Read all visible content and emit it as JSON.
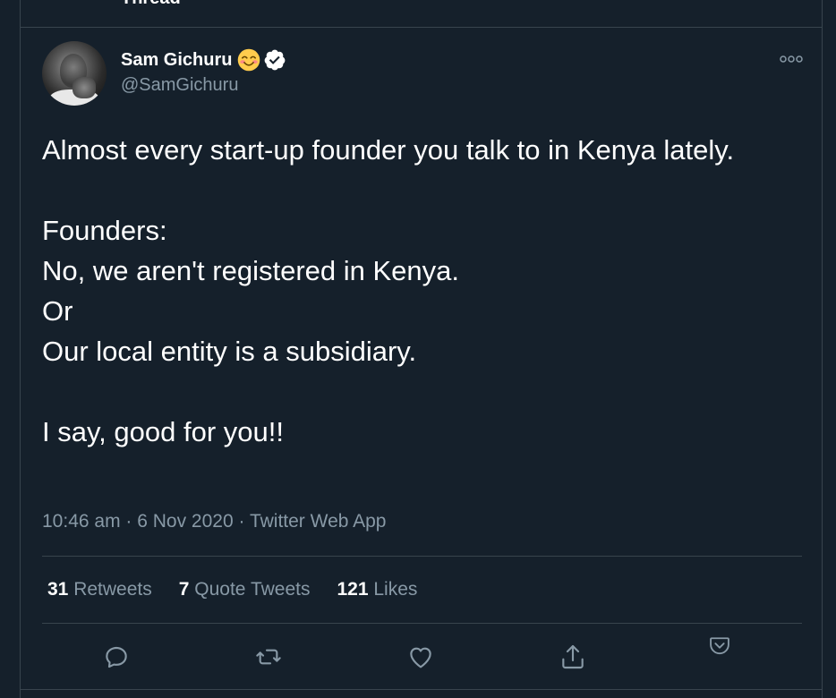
{
  "previous_header": "Thread",
  "author": {
    "display_name": "Sam Gichuru",
    "emoji_icon": "smiling-face-with-smiling-eyes",
    "verified_icon": "verified-badge",
    "handle": "@SamGichuru"
  },
  "tweet": {
    "text": "Almost every start-up founder you talk to in Kenya lately.\n\nFounders:\nNo, we aren't registered in Kenya.\nOr\nOur local entity is a subsidiary.\n\nI say, good for you!!",
    "time": "10:46 am",
    "separator": " · ",
    "date": "6 Nov 2020",
    "source": "Twitter Web App"
  },
  "stats": {
    "retweets_count": "31",
    "retweets_label": "Retweets",
    "quotes_count": "7",
    "quotes_label": "Quote Tweets",
    "likes_count": "121",
    "likes_label": "Likes"
  },
  "icons": {
    "more": "more-icon",
    "reply": "reply-icon",
    "retweet": "retweet-icon",
    "like": "heart-icon",
    "share": "share-icon",
    "bookmark": "pocket-icon"
  },
  "colors": {
    "background": "#15202b",
    "border": "#38444d",
    "secondary_text": "#8899a6",
    "primary_text": "#ffffff"
  }
}
